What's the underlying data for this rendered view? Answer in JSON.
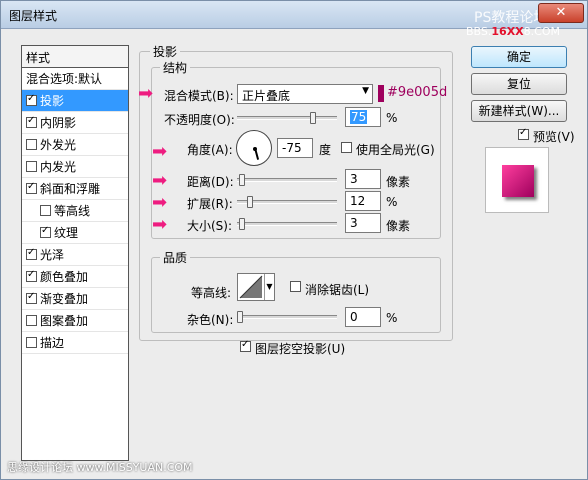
{
  "window": {
    "title": "图层样式"
  },
  "watermark": {
    "site_cn": "PS教程论坛",
    "site_pre": "BBS.",
    "site_mid": "16XX",
    "site_post": "8.COM",
    "bottom": "思缘设计论坛 www.MISSYUAN.COM"
  },
  "stylelist": {
    "header": "样式",
    "items": [
      {
        "label": "混合选项:默认",
        "checkbox": false,
        "checked": false,
        "selected": false,
        "indent": false
      },
      {
        "label": "投影",
        "checkbox": true,
        "checked": true,
        "selected": true,
        "indent": false
      },
      {
        "label": "内阴影",
        "checkbox": true,
        "checked": true,
        "selected": false,
        "indent": false
      },
      {
        "label": "外发光",
        "checkbox": true,
        "checked": false,
        "selected": false,
        "indent": false
      },
      {
        "label": "内发光",
        "checkbox": true,
        "checked": false,
        "selected": false,
        "indent": false
      },
      {
        "label": "斜面和浮雕",
        "checkbox": true,
        "checked": true,
        "selected": false,
        "indent": false
      },
      {
        "label": "等高线",
        "checkbox": true,
        "checked": false,
        "selected": false,
        "indent": true
      },
      {
        "label": "纹理",
        "checkbox": true,
        "checked": true,
        "selected": false,
        "indent": true
      },
      {
        "label": "光泽",
        "checkbox": true,
        "checked": true,
        "selected": false,
        "indent": false
      },
      {
        "label": "颜色叠加",
        "checkbox": true,
        "checked": true,
        "selected": false,
        "indent": false
      },
      {
        "label": "渐变叠加",
        "checkbox": true,
        "checked": true,
        "selected": false,
        "indent": false
      },
      {
        "label": "图案叠加",
        "checkbox": true,
        "checked": false,
        "selected": false,
        "indent": false
      },
      {
        "label": "描边",
        "checkbox": true,
        "checked": false,
        "selected": false,
        "indent": false
      }
    ]
  },
  "shadow": {
    "section_title": "投影",
    "structure_title": "结构",
    "blend_mode_label": "混合模式(B):",
    "blend_mode_value": "正片叠底",
    "color_hex": "#9e005d",
    "color_label": "#9e005d",
    "opacity_label": "不透明度(O):",
    "opacity_value": "75",
    "opacity_unit": "%",
    "angle_label": "角度(A):",
    "angle_value": "-75",
    "angle_unit": "度",
    "global_light_label": "使用全局光(G)",
    "distance_label": "距离(D):",
    "distance_value": "3",
    "distance_unit": "像素",
    "spread_label": "扩展(R):",
    "spread_value": "12",
    "spread_unit": "%",
    "size_label": "大小(S):",
    "size_value": "3",
    "size_unit": "像素",
    "quality_title": "品质",
    "contour_label": "等高线:",
    "antialias_label": "消除锯齿(L)",
    "noise_label": "杂色(N):",
    "noise_value": "0",
    "noise_unit": "%",
    "knockout_label": "图层挖空投影(U)"
  },
  "buttons": {
    "ok": "确定",
    "reset": "复位",
    "new_style": "新建样式(W)...",
    "preview_label": "预览(V)"
  },
  "accent": {
    "arrow": "#ee1c80",
    "selection": "#3399ff"
  }
}
